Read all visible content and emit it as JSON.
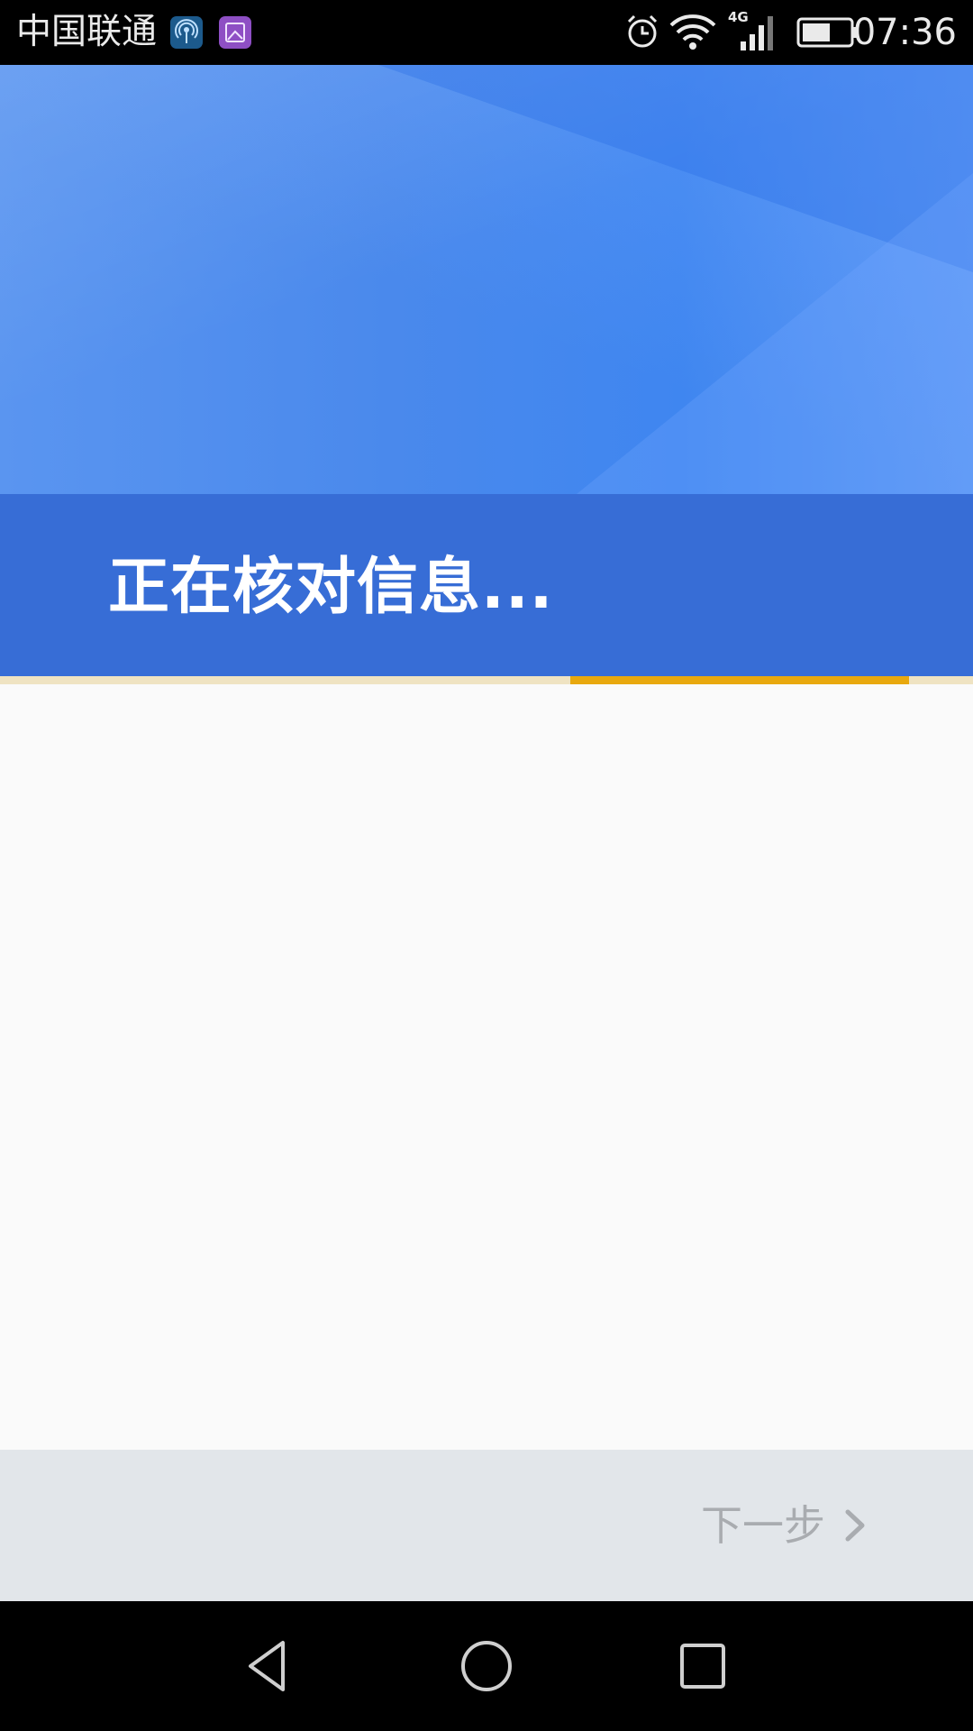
{
  "status_bar": {
    "carrier": "中国联通",
    "network_type": "4G",
    "time": "07:36",
    "battery_level": 0.6,
    "notification_icons": [
      "hotspot-icon",
      "gallery-icon"
    ],
    "status_icons": [
      "alarm-icon",
      "wifi-icon",
      "signal-icon",
      "battery-icon"
    ]
  },
  "header": {
    "title": "正在核对信息..."
  },
  "progress": {
    "segment_start": 0.586,
    "segment_end": 0.934,
    "colors": {
      "track": "#efe3c2",
      "fill": "#e8a80e"
    }
  },
  "footer": {
    "next_label": "下一步",
    "next_icon": "chevron-right-icon"
  },
  "nav_bar": {
    "buttons": [
      "back-icon",
      "home-icon",
      "recent-apps-icon"
    ]
  },
  "colors": {
    "header_band": "#376dd6",
    "header_hero": "#4a89ec",
    "content_bg": "#fafafa",
    "action_bar_bg": "#e2e6ea",
    "next_text": "#a9acb0"
  }
}
